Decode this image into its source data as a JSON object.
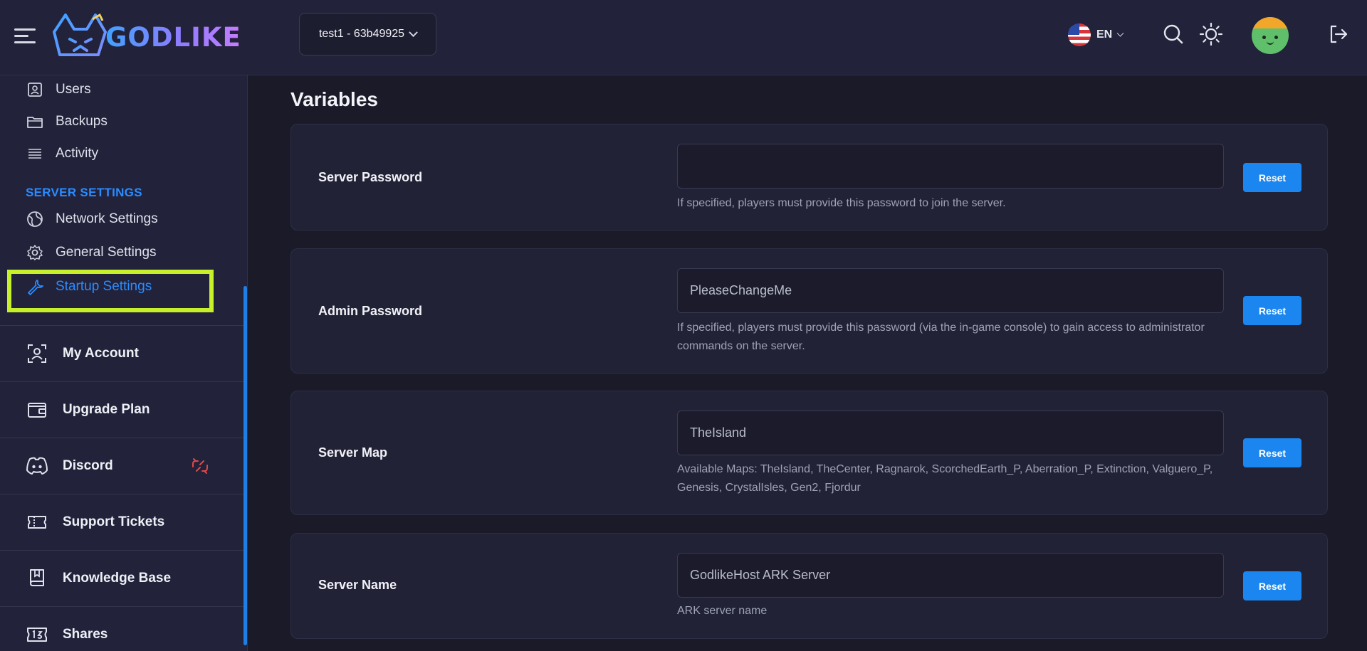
{
  "header": {
    "brand": "GODLIKE",
    "server_selector": "test1 - 63b49925",
    "language": "EN"
  },
  "sidebar": {
    "top_items": [
      {
        "label": "Users",
        "icon": "user-badge-icon"
      },
      {
        "label": "Backups",
        "icon": "folder-icon"
      },
      {
        "label": "Activity",
        "icon": "list-icon"
      }
    ],
    "section_title": "SERVER SETTINGS",
    "settings_items": [
      {
        "label": "Network Settings",
        "icon": "globe-icon"
      },
      {
        "label": "General Settings",
        "icon": "gear-icon"
      },
      {
        "label": "Startup Settings",
        "icon": "wrench-icon",
        "active": true
      }
    ],
    "account_items": [
      {
        "label": "My Account",
        "icon": "account-icon"
      },
      {
        "label": "Upgrade Plan",
        "icon": "wallet-icon"
      },
      {
        "label": "Discord",
        "icon": "discord-icon"
      },
      {
        "label": "Support Tickets",
        "icon": "ticket-icon"
      },
      {
        "label": "Knowledge Base",
        "icon": "book-icon"
      },
      {
        "label": "Shares",
        "icon": "shares-icon"
      }
    ]
  },
  "main": {
    "title": "Variables",
    "variables": [
      {
        "label": "Server Password",
        "value": "",
        "description": "If specified, players must provide this password to join the server.",
        "reset_label": "Reset"
      },
      {
        "label": "Admin Password",
        "value": "PleaseChangeMe",
        "description": "If specified, players must provide this password (via the in-game console) to gain access to administrator commands on the server.",
        "reset_label": "Reset"
      },
      {
        "label": "Server Map",
        "value": "TheIsland",
        "description": "Available Maps: TheIsland, TheCenter, Ragnarok, ScorchedEarth_P, Aberration_P, Extinction, Valguero_P, Genesis, CrystalIsles, Gen2, Fjordur",
        "reset_label": "Reset"
      },
      {
        "label": "Server Name",
        "value": "GodlikeHost ARK Server",
        "description": "ARK server name",
        "reset_label": "Reset"
      }
    ]
  },
  "colors": {
    "accent": "#2a8cff",
    "button": "#1b86f0",
    "highlight": "#c6f02a",
    "background": "#1a1a29",
    "panel": "#22223a"
  }
}
